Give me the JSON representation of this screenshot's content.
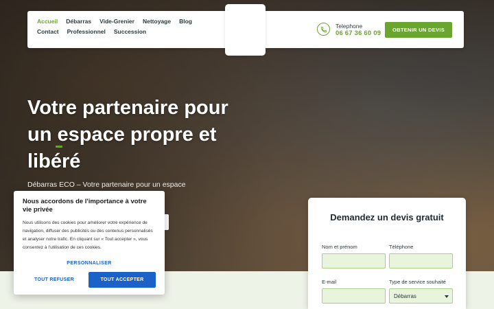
{
  "header": {
    "nav": [
      {
        "label": "Accueil",
        "active": true
      },
      {
        "label": "Débarras",
        "active": false
      },
      {
        "label": "Vide-Grenier",
        "active": false
      },
      {
        "label": "Nettoyage",
        "active": false
      },
      {
        "label": "Blog",
        "active": false
      },
      {
        "label": "Contact",
        "active": false
      },
      {
        "label": "Professionnel",
        "active": false
      },
      {
        "label": "Succession",
        "active": false
      }
    ],
    "phone_label": "Telephone",
    "phone_number": "06 67 36 60 09",
    "quote_button": "OBTENIR UN DEVIS",
    "phone_icon": "phone-icon"
  },
  "hero": {
    "title": "Votre partenaire pour un espace propre et libéré",
    "subtitle": "Débarras ECO – Votre partenaire pour un espace"
  },
  "cookie": {
    "title": "Nous accordons de l'importance à votre vie privée",
    "text": "Nous utilisons des cookies pour améliorer votre expérience de navigation, diffuser des publicités ou des contenus personnalisés et analyser notre trafic. En cliquant sur « Tout accepter », vous consentez à l'utilisation de ces cookies.",
    "customize": "PERSONNALISER",
    "refuse": "TOUT REFUSER",
    "accept": "TOUT ACCEPTER"
  },
  "form": {
    "title": "Demandez un devis gratuit",
    "name_label": "Nom et prénom",
    "phone_label": "Téléphone",
    "email_label": "E-mail",
    "service_label": "Type de service souhaité",
    "service_value": "Débarras"
  },
  "colors": {
    "accent": "#6aa62f",
    "cookie_blue": "#1a62c7"
  }
}
